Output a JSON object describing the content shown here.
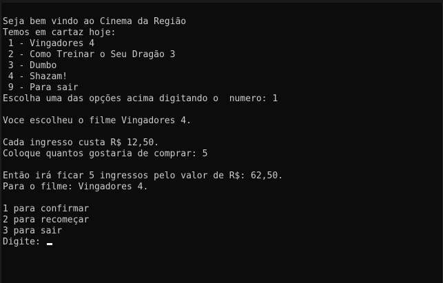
{
  "console": {
    "lines": [
      "Seja bem vindo ao Cinema da Região",
      "Temos em cartaz hoje:",
      " 1 - Vingadores 4",
      " 2 - Como Treinar o Seu Dragão 3",
      " 3 - Dumbo",
      " 4 - Shazam!",
      " 9 - Para sair",
      "Escolha uma das opções acima digitando o  numero: 1",
      "",
      "Voce escolheu o filme Vingadores 4.",
      "",
      "Cada ingresso custa R$ 12,50.",
      "Coloque quantos gostaria de comprar: 5",
      "",
      "Então irá ficar 5 ingressos pelo valor de R$: 62,50.",
      "Para o filme: Vingadores 4.",
      "",
      "1 para confirmar",
      "2 para recomeçar",
      "3 para sair"
    ],
    "prompt": "Digite: "
  },
  "colors": {
    "background": "#0c0c0c",
    "text": "#cccccc",
    "cursor": "#f2f2f2"
  }
}
